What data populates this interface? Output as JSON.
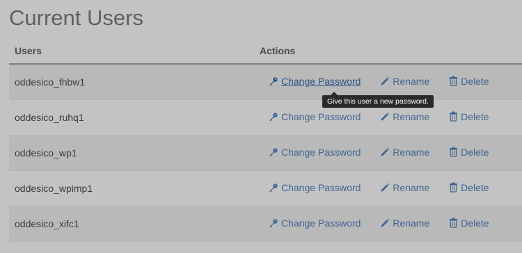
{
  "page": {
    "title": "Current Users"
  },
  "table": {
    "headers": {
      "users": "Users",
      "actions": "Actions"
    },
    "rows": [
      {
        "username": "oddesico_fhbw1"
      },
      {
        "username": "oddesico_ruhq1"
      },
      {
        "username": "oddesico_wp1"
      },
      {
        "username": "oddesico_wpimp1"
      },
      {
        "username": "oddesico_xifc1"
      }
    ],
    "actions": {
      "change_password": "Change Password",
      "rename": "Rename",
      "delete": "Delete"
    }
  },
  "tooltip": {
    "text": "Give this user a new password."
  },
  "colors": {
    "link": "#3f6692",
    "tooltip_bg": "#2a2a2a"
  }
}
